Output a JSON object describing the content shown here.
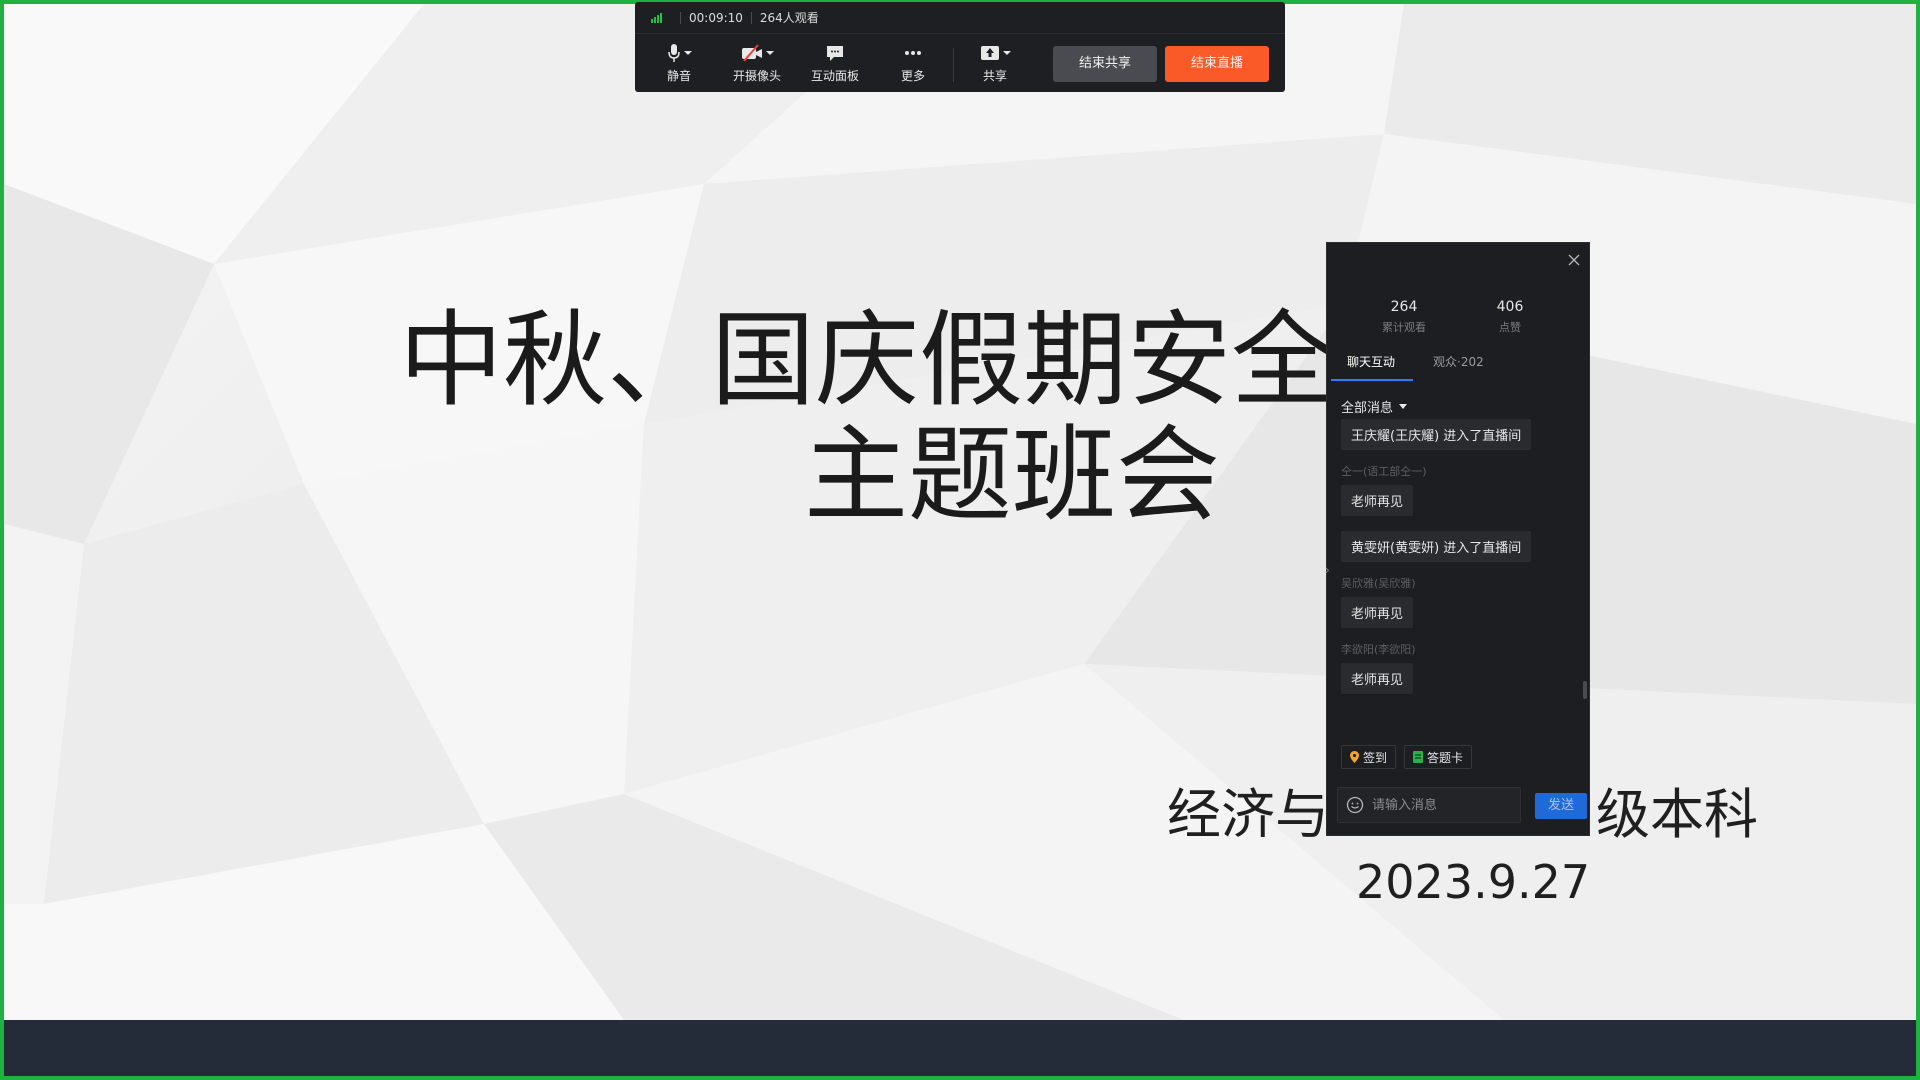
{
  "toolbar": {
    "timer": "00:09:10",
    "viewers": "264人观看",
    "tools": [
      {
        "label": "静音",
        "icon": "microphone-icon"
      },
      {
        "label": "开摄像头",
        "icon": "camera-off-icon"
      },
      {
        "label": "互动面板",
        "icon": "chat-bubble-icon"
      },
      {
        "label": "更多",
        "icon": "more-dots-icon"
      },
      {
        "label": "共享",
        "icon": "share-upload-icon"
      }
    ],
    "end_share_label": "结束共享",
    "end_live_label": "结束直播",
    "colors": {
      "accent": "#fa5a28",
      "signal": "#25c046"
    }
  },
  "slide": {
    "title_line1": "中秋、国庆假期安全教",
    "title_line2": "主题班会",
    "subtitle_left": "经济与",
    "subtitle_right": "级本科",
    "date": "2023.9.27"
  },
  "panel": {
    "stats": [
      {
        "value": "264",
        "caption": "累计观看"
      },
      {
        "value": "406",
        "caption": "点赞"
      }
    ],
    "tabs": [
      {
        "label": "聊天互动",
        "active": true
      },
      {
        "label": "观众·202",
        "active": false
      }
    ],
    "filter_label": "全部消息",
    "messages": [
      {
        "sender": "",
        "text": "王庆耀(王庆耀) 进入了直播间"
      },
      {
        "sender": "仝一(语工部仝一)",
        "text": "老师再见"
      },
      {
        "sender": "",
        "text": "黄雯妍(黄雯妍) 进入了直播间"
      },
      {
        "sender": "吴欣雅(吴欣雅)",
        "text": "老师再见"
      },
      {
        "sender": "李欲阳(李欲阳)",
        "text": "老师再见"
      }
    ],
    "quick_actions": [
      {
        "label": "签到",
        "icon": "location-pin-icon"
      },
      {
        "label": "答题卡",
        "icon": "card-icon"
      }
    ],
    "input_placeholder": "请输入消息",
    "send_label": "发送"
  }
}
